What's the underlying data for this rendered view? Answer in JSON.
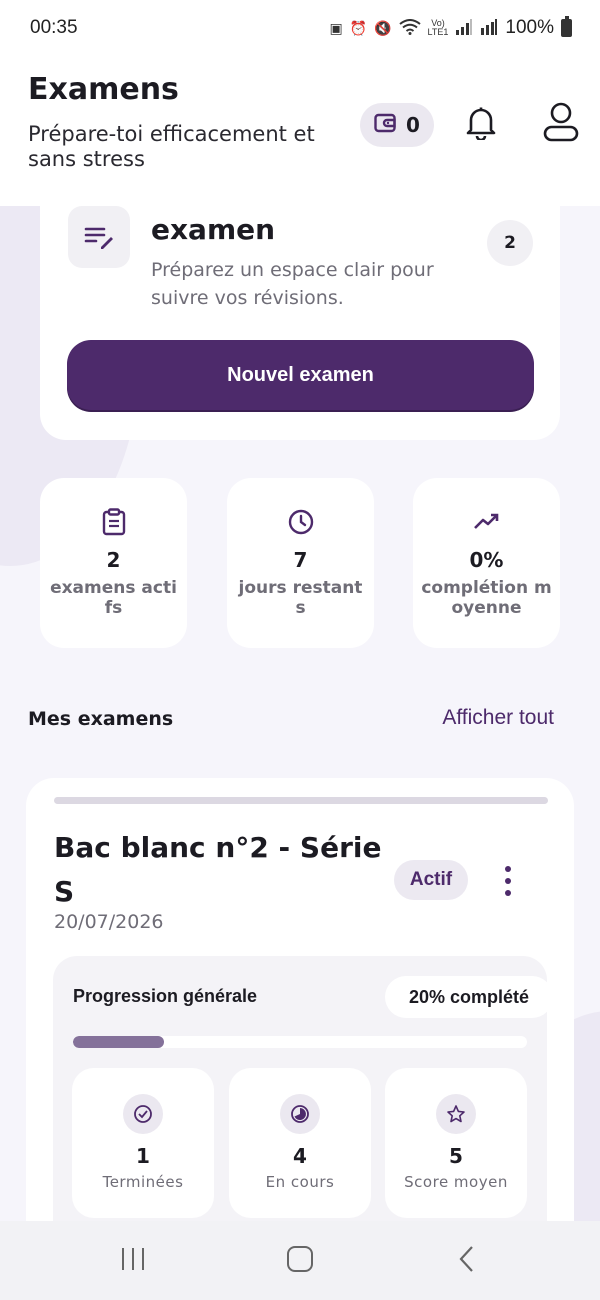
{
  "status_bar": {
    "time": "00:35",
    "battery": "100%"
  },
  "header": {
    "title": "Examens",
    "subtitle": "Prépare-toi efficacement et sans stress",
    "wallet_count": "0",
    "icons": [
      "wallet-icon",
      "bell-icon",
      "profile-icon"
    ]
  },
  "hero": {
    "title": "examen",
    "description": "Préparez un espace clair pour suivre vos révisions.",
    "count": "2",
    "button_label": "Nouvel examen",
    "icon": "edit-list-icon"
  },
  "stats": [
    {
      "icon": "clipboard-icon",
      "value": "2",
      "label": "examens actifs"
    },
    {
      "icon": "clock-icon",
      "value": "7",
      "label": "jours restants"
    },
    {
      "icon": "trending-up-icon",
      "value": "0%",
      "label": "complétion moyenne"
    }
  ],
  "exams_section": {
    "title": "Mes examens",
    "show_all": "Afficher tout"
  },
  "exam_card": {
    "title": "Bac blanc n°2 - Série S",
    "date": "20/07/2026",
    "status": "Actif",
    "progress": {
      "label": "Progression générale",
      "badge": "20% complété",
      "percent": 20
    },
    "metrics": [
      {
        "icon": "check-circle-icon",
        "value": "1",
        "label": "Terminées"
      },
      {
        "icon": "half-circle-icon",
        "value": "4",
        "label": "En cours"
      },
      {
        "icon": "star-icon",
        "value": "5",
        "label": "Score moyen"
      }
    ]
  },
  "colors": {
    "accent": "#4d2a6b",
    "progress_fill": "#84719a",
    "background": "#f6f5fb"
  }
}
